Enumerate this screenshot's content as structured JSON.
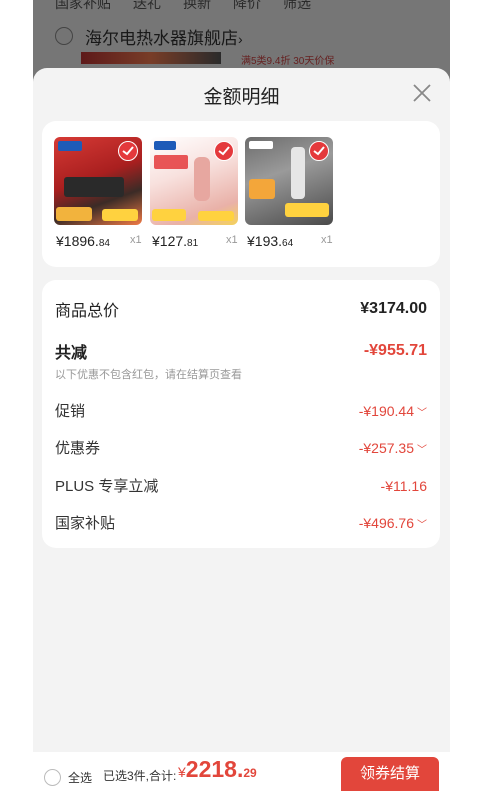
{
  "background": {
    "filters": [
      "国家补贴",
      "送礼",
      "换新",
      "降价",
      "筛选"
    ],
    "store_name": "海尔电热水器旗舰店",
    "store_chevron": "›",
    "store_promo": "满5类9.4折  30天价保"
  },
  "sheet": {
    "title": "金额明细",
    "close_icon": "close-icon"
  },
  "products": [
    {
      "price_main": "¥1896.",
      "price_cents": "84",
      "qty": "x1",
      "brand_color": "#c62a2a"
    },
    {
      "price_main": "¥127.",
      "price_cents": "81",
      "qty": "x1",
      "brand_color": "#e8b0ab"
    },
    {
      "price_main": "¥193.",
      "price_cents": "64",
      "qty": "x1",
      "brand_color": "#8b8b8b"
    }
  ],
  "summary": {
    "total_label": "商品总价",
    "total_value": "¥3174.00",
    "discount_label": "共减",
    "discount_value": "-¥955.71",
    "note": "以下优惠不包含红包，请在结算页查看",
    "rows": [
      {
        "label": "促销",
        "value": "-¥190.44",
        "expandable": true
      },
      {
        "label": "优惠券",
        "value": "-¥257.35",
        "expandable": true
      },
      {
        "label": "PLUS 专享立减",
        "value": "-¥11.16",
        "expandable": false
      },
      {
        "label": "国家补贴",
        "value": "-¥496.76",
        "expandable": true
      }
    ]
  },
  "footer": {
    "select_all": "全选",
    "selected_summary": "已选3件,合计:",
    "amount_symbol": "¥",
    "amount_main": "2218.",
    "amount_cents": "29",
    "checkout_label": "领券结算"
  },
  "colors": {
    "accent": "#e2463b",
    "overlay": "rgba(0,0,0,0.5)",
    "sheet_bg": "#f3f3f3"
  }
}
